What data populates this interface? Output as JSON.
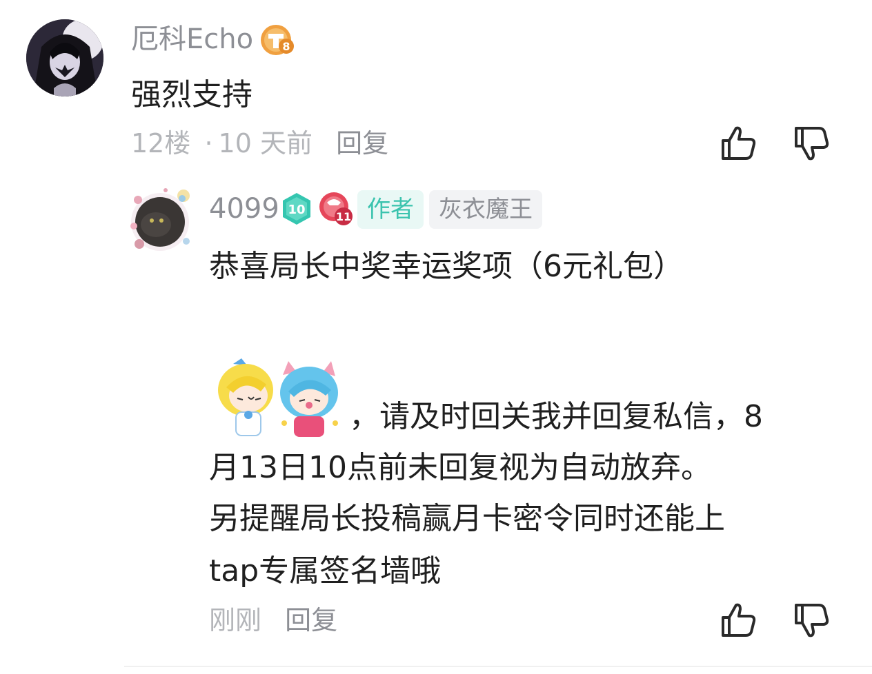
{
  "comment": {
    "username": "厄科Echo",
    "level_badge": "8",
    "content": "强烈支持",
    "floor": "12楼",
    "separator": "·",
    "time": "10 天前",
    "reply_label": "回复",
    "icons": [
      "like-icon",
      "dislike-icon"
    ]
  },
  "reply": {
    "username": "4099",
    "level_badge": "10",
    "fan_badge": "11",
    "author_tag": "作者",
    "title_tag": "灰衣魔王",
    "line1": "恭喜局长中奖幸运奖项（6元礼包）",
    "line2": "，请及时回关我并回复私信，8",
    "line3": "月13日10点前未回复视为自动放弃。",
    "line4": "另提醒局长投稿赢月卡密令同时还能上",
    "line5": "tap专属签名墙哦",
    "time": "刚刚",
    "reply_label": "回复",
    "icons": [
      "like-icon",
      "dislike-icon"
    ]
  },
  "colors": {
    "accent_green": "#3bc3ae",
    "tag_bg": "#e9f8f5",
    "meta_gray": "#b3b5b9",
    "name_gray": "#8d8f95",
    "badge_orange": "#f0a040",
    "badge_teal": "#35c6b0",
    "badge_red": "#e6465a"
  }
}
